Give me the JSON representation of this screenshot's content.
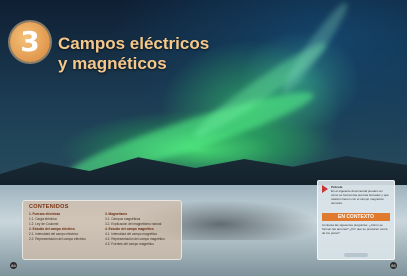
{
  "chapter": {
    "number": "3",
    "title_line1": "Campos eléctricos",
    "title_line2": "y magnéticos"
  },
  "contents": {
    "heading": "CONTENIDOS",
    "col1": [
      {
        "text": "1. Fuerzas eléctricas",
        "head": true
      },
      {
        "text": "1.1. Carga eléctrica",
        "head": false
      },
      {
        "text": "1.2. Ley de Coulomb",
        "head": false
      },
      {
        "text": "2. Estudio del campo eléctrico",
        "head": true
      },
      {
        "text": "2.1. Intensidad del campo eléctrico",
        "head": false
      },
      {
        "text": "2.2. Representación del campo eléctrico",
        "head": false
      }
    ],
    "col2": [
      {
        "text": "3. Magnetismo",
        "head": true
      },
      {
        "text": "3.1. Campos magnéticos",
        "head": false
      },
      {
        "text": "3.2. Explicación del magnetismo natural",
        "head": false
      },
      {
        "text": "4. Estudio del campo magnético",
        "head": true
      },
      {
        "text": "4.1. Intensidad del campo magnético",
        "head": false
      },
      {
        "text": "4.2. Representación del campo magnético",
        "head": false
      },
      {
        "text": "4.3. Fuentes del campo magnético",
        "head": false
      }
    ]
  },
  "sidebar": {
    "top_head": "Película",
    "top_text": "En el siguiente documental puedes ver cómo se forman las auroras boreales y qué relación tienen con el campo magnético terrestre.",
    "banner": "EN CONTEXTO",
    "body": "Contesta las siguientes preguntas. ¿Cómo se forman las auroras? ¿Por qué se producen cerca de los polos?",
    "link_label": ""
  },
  "page_numbers": {
    "left": "84",
    "right": "85"
  },
  "colors": {
    "title": "#f6c88a",
    "banner": "#e07a2e",
    "badge": "#d9853a"
  }
}
